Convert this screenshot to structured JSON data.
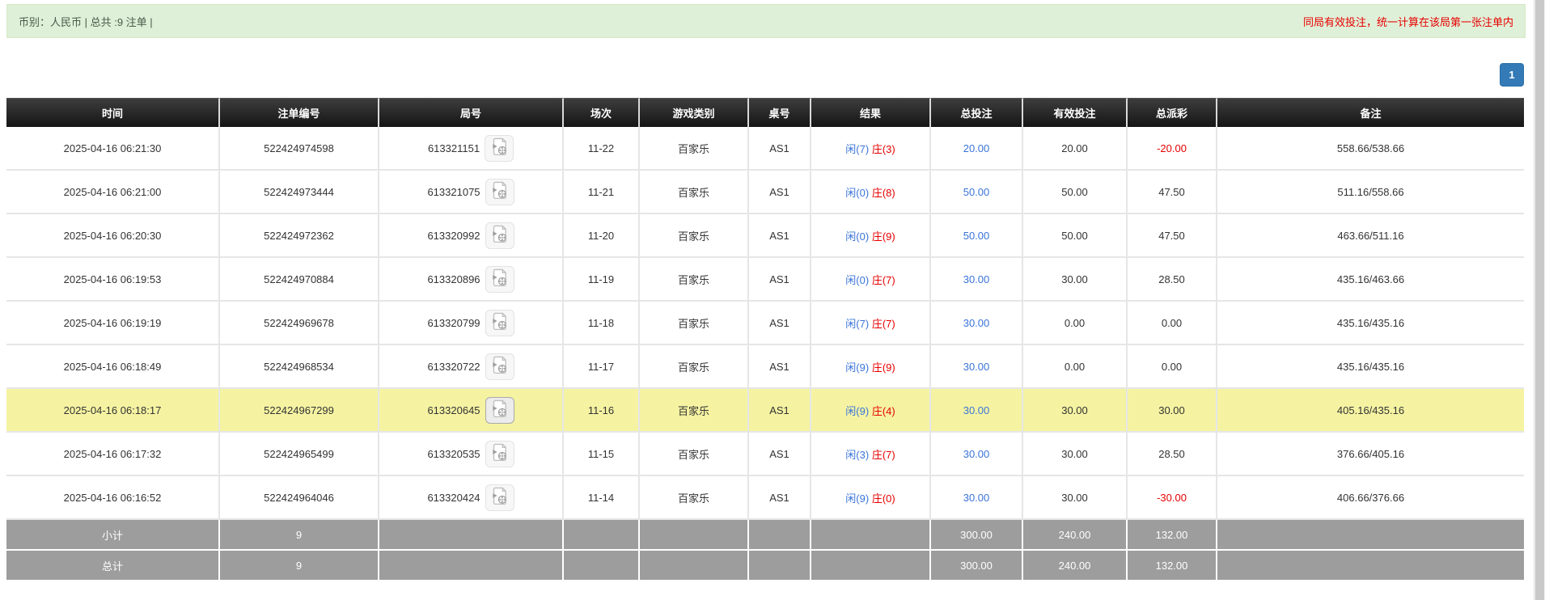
{
  "notice": {
    "left": "币别：人民币 | 总共 :9 注单 |",
    "right": "同局有效投注，统一计算在该局第一张注单内"
  },
  "pagination": {
    "current_page": "1"
  },
  "icons": {
    "video_icon": "video-record-icon"
  },
  "colors": {
    "notice-bg": "#dff0d8",
    "notice-border": "#d6e9c6",
    "accent-blue": "#337ab7",
    "accent-blue-text": "#3a74d8",
    "negative-red": "#e60000",
    "highlight-yellow": "#f5f3a2",
    "summary-gray": "#9d9d9d",
    "scrollbar-thumb": "#c9c9c9"
  },
  "table": {
    "columns": [
      "时间",
      "注单编号",
      "局号",
      "场次",
      "游戏类别",
      "桌号",
      "结果",
      "总投注",
      "有效投注",
      "总派彩",
      "备注"
    ],
    "rows": [
      {
        "time": "2025-04-16 06:21:30",
        "bet_id": "522424974598",
        "round_id": "613321151",
        "session": "11-22",
        "game_type": "百家乐",
        "table_id": "AS1",
        "result_player": "闲(7)",
        "result_banker": "庄(3)",
        "total_bet": "20.00",
        "valid_bet": "20.00",
        "payout": "-20.00",
        "remark": "558.66/538.66",
        "highlighted": false
      },
      {
        "time": "2025-04-16 06:21:00",
        "bet_id": "522424973444",
        "round_id": "613321075",
        "session": "11-21",
        "game_type": "百家乐",
        "table_id": "AS1",
        "result_player": "闲(0)",
        "result_banker": "庄(8)",
        "total_bet": "50.00",
        "valid_bet": "50.00",
        "payout": "47.50",
        "remark": "511.16/558.66",
        "highlighted": false
      },
      {
        "time": "2025-04-16 06:20:30",
        "bet_id": "522424972362",
        "round_id": "613320992",
        "session": "11-20",
        "game_type": "百家乐",
        "table_id": "AS1",
        "result_player": "闲(0)",
        "result_banker": "庄(9)",
        "total_bet": "50.00",
        "valid_bet": "50.00",
        "payout": "47.50",
        "remark": "463.66/511.16",
        "highlighted": false
      },
      {
        "time": "2025-04-16 06:19:53",
        "bet_id": "522424970884",
        "round_id": "613320896",
        "session": "11-19",
        "game_type": "百家乐",
        "table_id": "AS1",
        "result_player": "闲(0)",
        "result_banker": "庄(7)",
        "total_bet": "30.00",
        "valid_bet": "30.00",
        "payout": "28.50",
        "remark": "435.16/463.66",
        "highlighted": false
      },
      {
        "time": "2025-04-16 06:19:19",
        "bet_id": "522424969678",
        "round_id": "613320799",
        "session": "11-18",
        "game_type": "百家乐",
        "table_id": "AS1",
        "result_player": "闲(7)",
        "result_banker": "庄(7)",
        "total_bet": "30.00",
        "valid_bet": "0.00",
        "payout": "0.00",
        "remark": "435.16/435.16",
        "highlighted": false
      },
      {
        "time": "2025-04-16 06:18:49",
        "bet_id": "522424968534",
        "round_id": "613320722",
        "session": "11-17",
        "game_type": "百家乐",
        "table_id": "AS1",
        "result_player": "闲(9)",
        "result_banker": "庄(9)",
        "total_bet": "30.00",
        "valid_bet": "0.00",
        "payout": "0.00",
        "remark": "435.16/435.16",
        "highlighted": false
      },
      {
        "time": "2025-04-16 06:18:17",
        "bet_id": "522424967299",
        "round_id": "613320645",
        "session": "11-16",
        "game_type": "百家乐",
        "table_id": "AS1",
        "result_player": "闲(9)",
        "result_banker": "庄(4)",
        "total_bet": "30.00",
        "valid_bet": "30.00",
        "payout": "30.00",
        "remark": "405.16/435.16",
        "highlighted": true
      },
      {
        "time": "2025-04-16 06:17:32",
        "bet_id": "522424965499",
        "round_id": "613320535",
        "session": "11-15",
        "game_type": "百家乐",
        "table_id": "AS1",
        "result_player": "闲(3)",
        "result_banker": "庄(7)",
        "total_bet": "30.00",
        "valid_bet": "30.00",
        "payout": "28.50",
        "remark": "376.66/405.16",
        "highlighted": false
      },
      {
        "time": "2025-04-16 06:16:52",
        "bet_id": "522424964046",
        "round_id": "613320424",
        "session": "11-14",
        "game_type": "百家乐",
        "table_id": "AS1",
        "result_player": "闲(9)",
        "result_banker": "庄(0)",
        "total_bet": "30.00",
        "valid_bet": "30.00",
        "payout": "-30.00",
        "remark": "406.66/376.66",
        "highlighted": false
      }
    ],
    "subtotal": {
      "label": "小计",
      "count": "9",
      "total_bet": "300.00",
      "valid_bet": "240.00",
      "payout": "132.00"
    },
    "total": {
      "label": "总计",
      "count": "9",
      "total_bet": "300.00",
      "valid_bet": "240.00",
      "payout": "132.00"
    }
  }
}
